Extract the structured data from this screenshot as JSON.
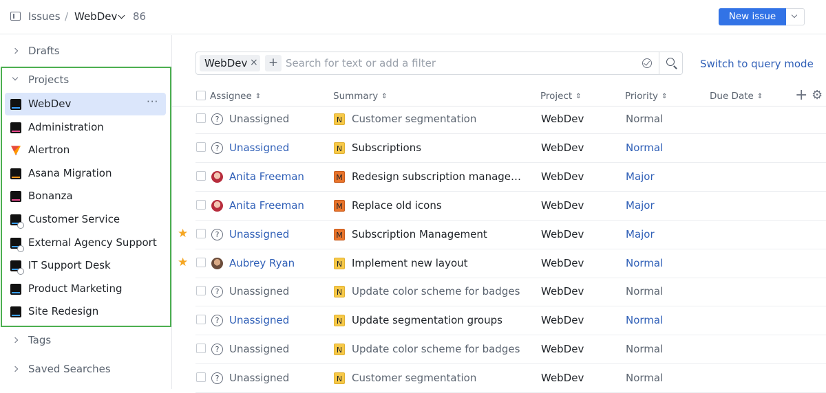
{
  "header": {
    "breadcrumb_issues": "Issues",
    "breadcrumb_sep": "/",
    "project": "WebDev",
    "count": "86",
    "new_issue_label": "New issue"
  },
  "sidebar": {
    "drafts": "Drafts",
    "projects_label": "Projects",
    "projects": [
      {
        "name": "WebDev",
        "logo": "WD",
        "active": true
      },
      {
        "name": "Administration",
        "logo": "ADM"
      },
      {
        "name": "Alertron",
        "logo": "alertron"
      },
      {
        "name": "Asana Migration",
        "logo": "AM"
      },
      {
        "name": "Bonanza",
        "logo": "BON"
      },
      {
        "name": "Customer Service",
        "logo": "CS",
        "badge": true
      },
      {
        "name": "External Agency Support",
        "logo": "AGN",
        "badge": true
      },
      {
        "name": "IT Support Desk",
        "logo": "ITS",
        "badge": true
      },
      {
        "name": "Product Marketing",
        "logo": "PM"
      },
      {
        "name": "Site Redesign",
        "logo": "SR"
      }
    ],
    "more_label": "···",
    "tags": "Tags",
    "saved_searches": "Saved Searches"
  },
  "filter": {
    "chip": "WebDev",
    "chip_remove": "×",
    "add": "+",
    "placeholder": "Search for text or add a filter",
    "query_mode": "Switch to query mode"
  },
  "table": {
    "columns": [
      "Assignee",
      "Summary",
      "Project",
      "Priority",
      "Due Date"
    ],
    "sort_glyph": "⇕",
    "rows": [
      {
        "star": false,
        "avatar": "q",
        "assignee": "Unassigned",
        "assignee_style": "gray",
        "tag": "N",
        "summary": "Customer segmentation",
        "summary_style": "gray",
        "project": "WebDev",
        "priority": "Normal",
        "priority_style": "gray"
      },
      {
        "star": false,
        "avatar": "q",
        "assignee": "Unassigned",
        "assignee_style": "link",
        "tag": "N",
        "summary": "Subscriptions",
        "summary_style": "dark",
        "project": "WebDev",
        "priority": "Normal",
        "priority_style": "link"
      },
      {
        "star": false,
        "avatar": "anita",
        "assignee": "Anita Freeman",
        "assignee_style": "link",
        "tag": "M",
        "summary": "Redesign subscription managem...",
        "summary_style": "dark",
        "project": "WebDev",
        "priority": "Major",
        "priority_style": "link"
      },
      {
        "star": false,
        "avatar": "anita",
        "assignee": "Anita Freeman",
        "assignee_style": "link",
        "tag": "M",
        "summary": "Replace old icons",
        "summary_style": "dark",
        "project": "WebDev",
        "priority": "Major",
        "priority_style": "link"
      },
      {
        "star": true,
        "avatar": "q",
        "assignee": "Unassigned",
        "assignee_style": "link",
        "tag": "M",
        "summary": "Subscription Management",
        "summary_style": "dark",
        "project": "WebDev",
        "priority": "Major",
        "priority_style": "link"
      },
      {
        "star": true,
        "avatar": "aubrey",
        "assignee": "Aubrey Ryan",
        "assignee_style": "link",
        "tag": "N",
        "summary": "Implement new layout",
        "summary_style": "dark",
        "project": "WebDev",
        "priority": "Normal",
        "priority_style": "link"
      },
      {
        "star": false,
        "avatar": "q",
        "assignee": "Unassigned",
        "assignee_style": "gray",
        "tag": "N",
        "summary": "Update color scheme for badges",
        "summary_style": "gray",
        "project": "WebDev",
        "priority": "Normal",
        "priority_style": "gray"
      },
      {
        "star": false,
        "avatar": "q",
        "assignee": "Unassigned",
        "assignee_style": "link",
        "tag": "N",
        "summary": "Update segmentation groups",
        "summary_style": "dark",
        "project": "WebDev",
        "priority": "Normal",
        "priority_style": "link"
      },
      {
        "star": false,
        "avatar": "q",
        "assignee": "Unassigned",
        "assignee_style": "gray",
        "tag": "N",
        "summary": "Update color scheme for badges",
        "summary_style": "gray",
        "project": "WebDev",
        "priority": "Normal",
        "priority_style": "gray"
      },
      {
        "star": false,
        "avatar": "q",
        "assignee": "Unassigned",
        "assignee_style": "gray",
        "tag": "N",
        "summary": "Customer segmentation",
        "summary_style": "gray",
        "project": "WebDev",
        "priority": "Normal",
        "priority_style": "gray"
      }
    ]
  },
  "colors": {
    "accent": "#3273e6",
    "link": "#2f5fb7",
    "selection_box": "#4caf50",
    "star": "#f5a623"
  }
}
